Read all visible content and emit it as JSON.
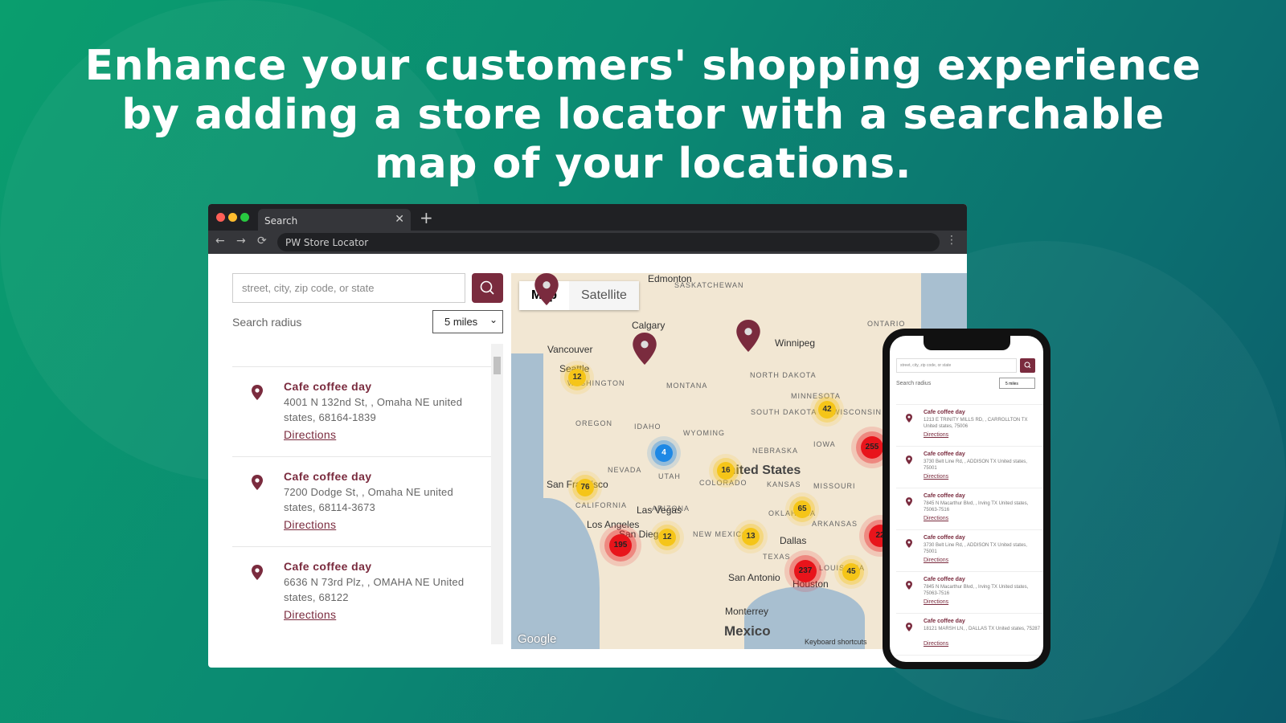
{
  "headline": "Enhance your customers' shopping experience by adding a store locator with a searchable map of your locations.",
  "browser": {
    "tab_title": "Search",
    "address": "PW Store Locator"
  },
  "search": {
    "placeholder": "street, city, zip code, or state",
    "radius_label": "Search radius",
    "radius_value": "5 miles"
  },
  "stores": [
    {
      "name": "Cafe coffee day",
      "address": "4001 N 132nd St, , Omaha NE united states, 68164-1839",
      "directions": "Directions"
    },
    {
      "name": "Cafe coffee day",
      "address": "7200 Dodge St, , Omaha NE united states, 68114-3673",
      "directions": "Directions"
    },
    {
      "name": "Cafe coffee day",
      "address": "6636 N 73rd Plz, , OMAHA NE United states, 68122",
      "directions": "Directions"
    }
  ],
  "map": {
    "type_map": "Map",
    "type_satellite": "Satellite",
    "google": "Google",
    "keyboard": "Keyboard shortcuts",
    "labels": [
      "SASKATCHEWAN",
      "ONTARIO",
      "WASHINGTON",
      "MONTANA",
      "NORTH DAKOTA",
      "MINNESOTA",
      "OREGON",
      "IDAHO",
      "WYOMING",
      "SOUTH DAKOTA",
      "WISCONSIN",
      "NEBRASKA",
      "IOWA",
      "NEVADA",
      "UTAH",
      "COLORADO",
      "KANSAS",
      "MISSOURI",
      "CALIFORNIA",
      "ARIZONA",
      "NEW MEXICO",
      "OKLAHOMA",
      "ARKANSAS",
      "TEXAS",
      "LOUISIANA"
    ],
    "cities": [
      "Calgary",
      "Vancouver",
      "Seattle",
      "Winnipeg",
      "San Francisco",
      "Las Vegas",
      "Los Angeles",
      "San Diego",
      "Dallas",
      "San Antonio",
      "Houston",
      "Monterrey",
      "Edmonton"
    ],
    "country_us": "United States",
    "country_mx": "Mexico",
    "clusters": [
      {
        "count": "12",
        "color": "yellow"
      },
      {
        "count": "4",
        "color": "blue"
      },
      {
        "count": "16",
        "color": "yellow"
      },
      {
        "count": "76",
        "color": "yellow"
      },
      {
        "count": "195",
        "color": "red"
      },
      {
        "count": "12",
        "color": "yellow"
      },
      {
        "count": "13",
        "color": "yellow"
      },
      {
        "count": "65",
        "color": "yellow"
      },
      {
        "count": "42",
        "color": "yellow"
      },
      {
        "count": "255",
        "color": "red"
      },
      {
        "count": "237",
        "color": "red"
      },
      {
        "count": "45",
        "color": "yellow"
      },
      {
        "count": "22",
        "color": "red"
      }
    ]
  },
  "phone": {
    "placeholder": "street, city, zip code, or state",
    "radius_label": "Search radius",
    "radius_value": "5 miles",
    "stores": [
      {
        "name": "Cafe coffee day",
        "address": "1213 E TRINITY MILLS RD, , CARROLLTON TX United states, 75006",
        "directions": "Directions"
      },
      {
        "name": "Cafe coffee day",
        "address": "3730 Belt Line Rd, , ADDISON TX United states, 75001",
        "directions": "Directions"
      },
      {
        "name": "Cafe coffee day",
        "address": "7845 N Macarthur Blvd, , Irving TX United states, 75063-7516",
        "directions": "Directions"
      },
      {
        "name": "Cafe coffee day",
        "address": "3730 Belt Line Rd, , ADDISON TX United states, 75001",
        "directions": "Directions"
      },
      {
        "name": "Cafe coffee day",
        "address": "7845 N Macarthur Blvd, , Irving TX United states, 75063-7516",
        "directions": "Directions"
      },
      {
        "name": "Cafe coffee day",
        "address": "18121 MARSH LN, , DALLAS TX United states, 75287",
        "directions": "Directions"
      }
    ]
  },
  "colors": {
    "brand": "#7a2b3e",
    "bg_start": "#0a9e6e",
    "bg_end": "#0b5a6a"
  }
}
